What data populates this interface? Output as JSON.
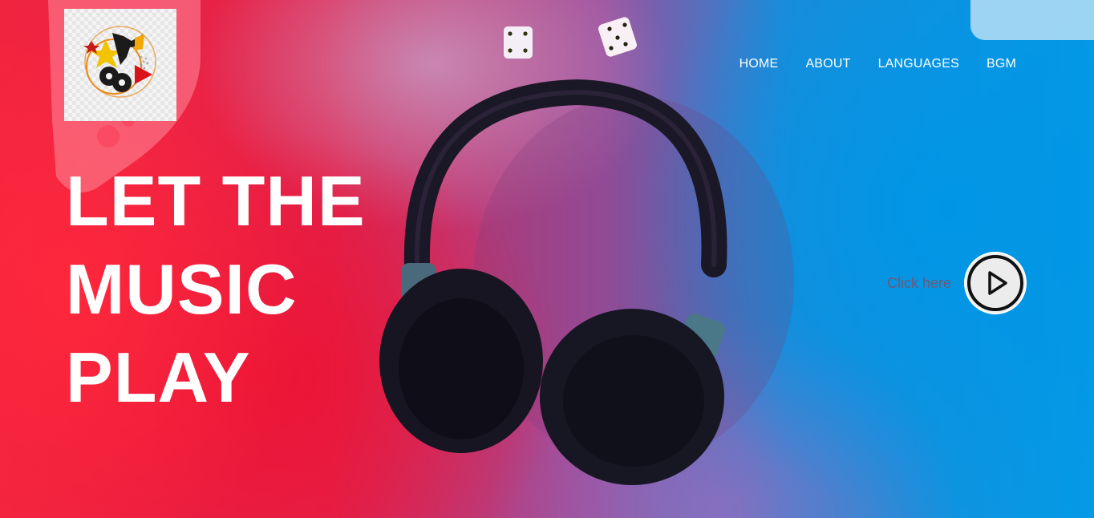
{
  "nav": {
    "items": [
      {
        "label": "HOME"
      },
      {
        "label": "ABOUT"
      },
      {
        "label": "LANGUAGES"
      },
      {
        "label": "BGM"
      }
    ]
  },
  "hero": {
    "headline_lines": [
      "LET THE",
      "MUSIC",
      "PLAY"
    ],
    "cta_label": "Click here"
  },
  "icons": {
    "logo": "music-dj-logo-icon",
    "play": "play-circle-icon"
  },
  "colors": {
    "left_glow": "#f0243f",
    "right_glow": "#039ae6",
    "text": "#ffffff",
    "cta_text": "#6d5a77"
  }
}
